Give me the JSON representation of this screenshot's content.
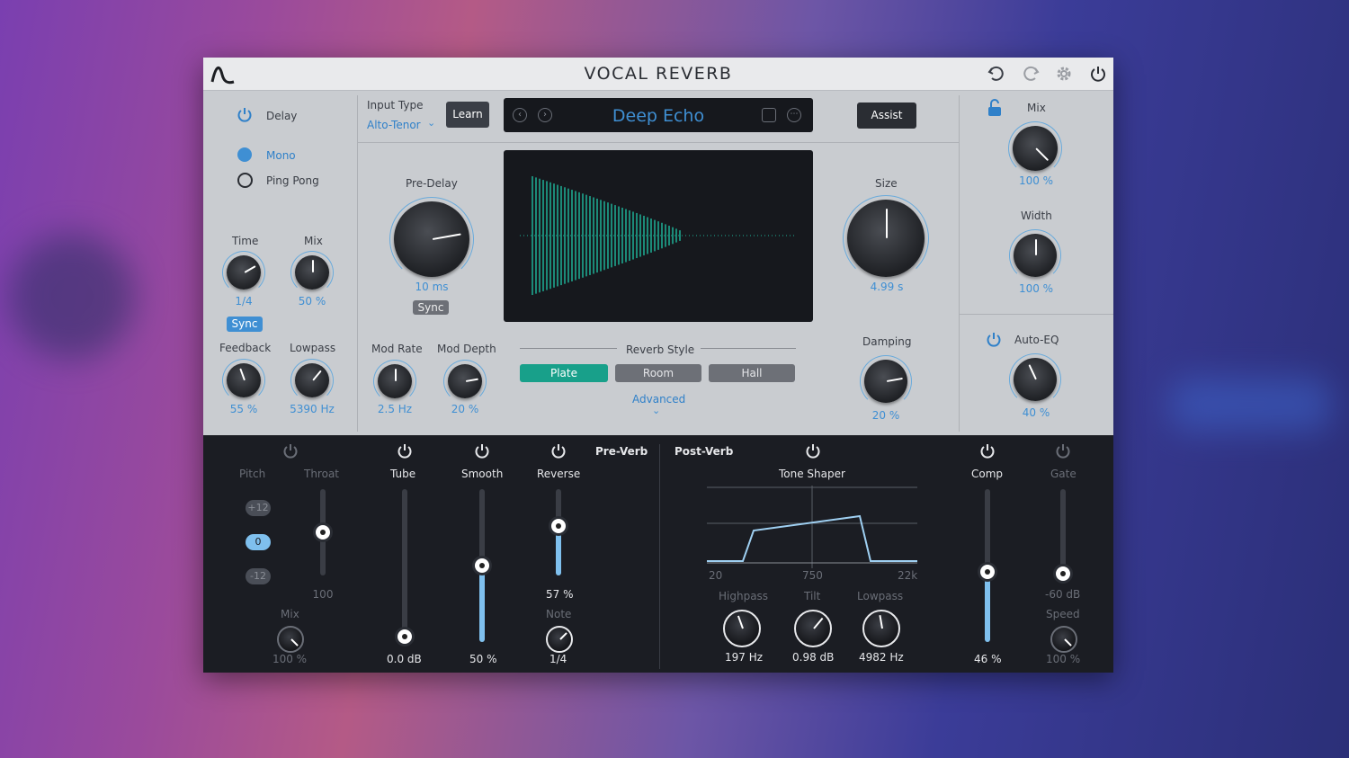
{
  "app": {
    "title": "VOCAL REVERB"
  },
  "delay": {
    "label": "Delay",
    "modes": [
      "Mono",
      "Ping Pong"
    ],
    "selected_mode": "Mono",
    "time_label": "Time",
    "time_value": "1/4",
    "mix_label": "Mix",
    "mix_value": "50 %",
    "sync_label": "Sync",
    "feedback_label": "Feedback",
    "feedback_value": "55 %",
    "lowpass_label": "Lowpass",
    "lowpass_value": "5390 Hz"
  },
  "input": {
    "label": "Input Type",
    "value": "Alto-Tenor",
    "learn_label": "Learn"
  },
  "preset": {
    "name": "Deep Echo"
  },
  "assist_label": "Assist",
  "reverb": {
    "predelay_label": "Pre-Delay",
    "predelay_value": "10 ms",
    "sync_label": "Sync",
    "size_label": "Size",
    "size_value": "4.99 s",
    "modrate_label": "Mod Rate",
    "modrate_value": "2.5 Hz",
    "moddepth_label": "Mod Depth",
    "moddepth_value": "20 %",
    "style_label": "Reverb Style",
    "styles": [
      "Plate",
      "Room",
      "Hall"
    ],
    "selected_style": "Plate",
    "advanced_label": "Advanced",
    "damping_label": "Damping",
    "damping_value": "20 %"
  },
  "output": {
    "mix_label": "Mix",
    "mix_value": "100 %",
    "width_label": "Width",
    "width_value": "100 %",
    "autoeq_label": "Auto-EQ",
    "autoeq_value": "40 %"
  },
  "preverb": {
    "title": "Pre-Verb",
    "pitch_label": "Pitch",
    "pitch_steps": [
      "+12",
      "0",
      "-12"
    ],
    "throat_label": "Throat",
    "throat_value": "100",
    "pitch_mix_label": "Mix",
    "pitch_mix_value": "100 %",
    "tube_label": "Tube",
    "tube_value": "0.0 dB",
    "smooth_label": "Smooth",
    "smooth_value": "50 %",
    "reverse_label": "Reverse",
    "reverse_value": "57 %",
    "note_label": "Note",
    "note_value": "1/4"
  },
  "postverb": {
    "title": "Post-Verb",
    "toneshaper_label": "Tone Shaper",
    "axis": [
      "20",
      "750",
      "22k"
    ],
    "highpass_label": "Highpass",
    "highpass_value": "197 Hz",
    "tilt_label": "Tilt",
    "tilt_value": "0.98 dB",
    "lowpass_label": "Lowpass",
    "lowpass_value": "4982 Hz",
    "comp_label": "Comp",
    "comp_value": "46 %",
    "gate_label": "Gate",
    "gate_value": "-60 dB",
    "speed_label": "Speed",
    "speed_value": "100 %"
  },
  "colors": {
    "accent": "#2f80c9",
    "teal": "#18a08a",
    "panel": "#c9ccd0",
    "dark": "#1b1d23"
  }
}
